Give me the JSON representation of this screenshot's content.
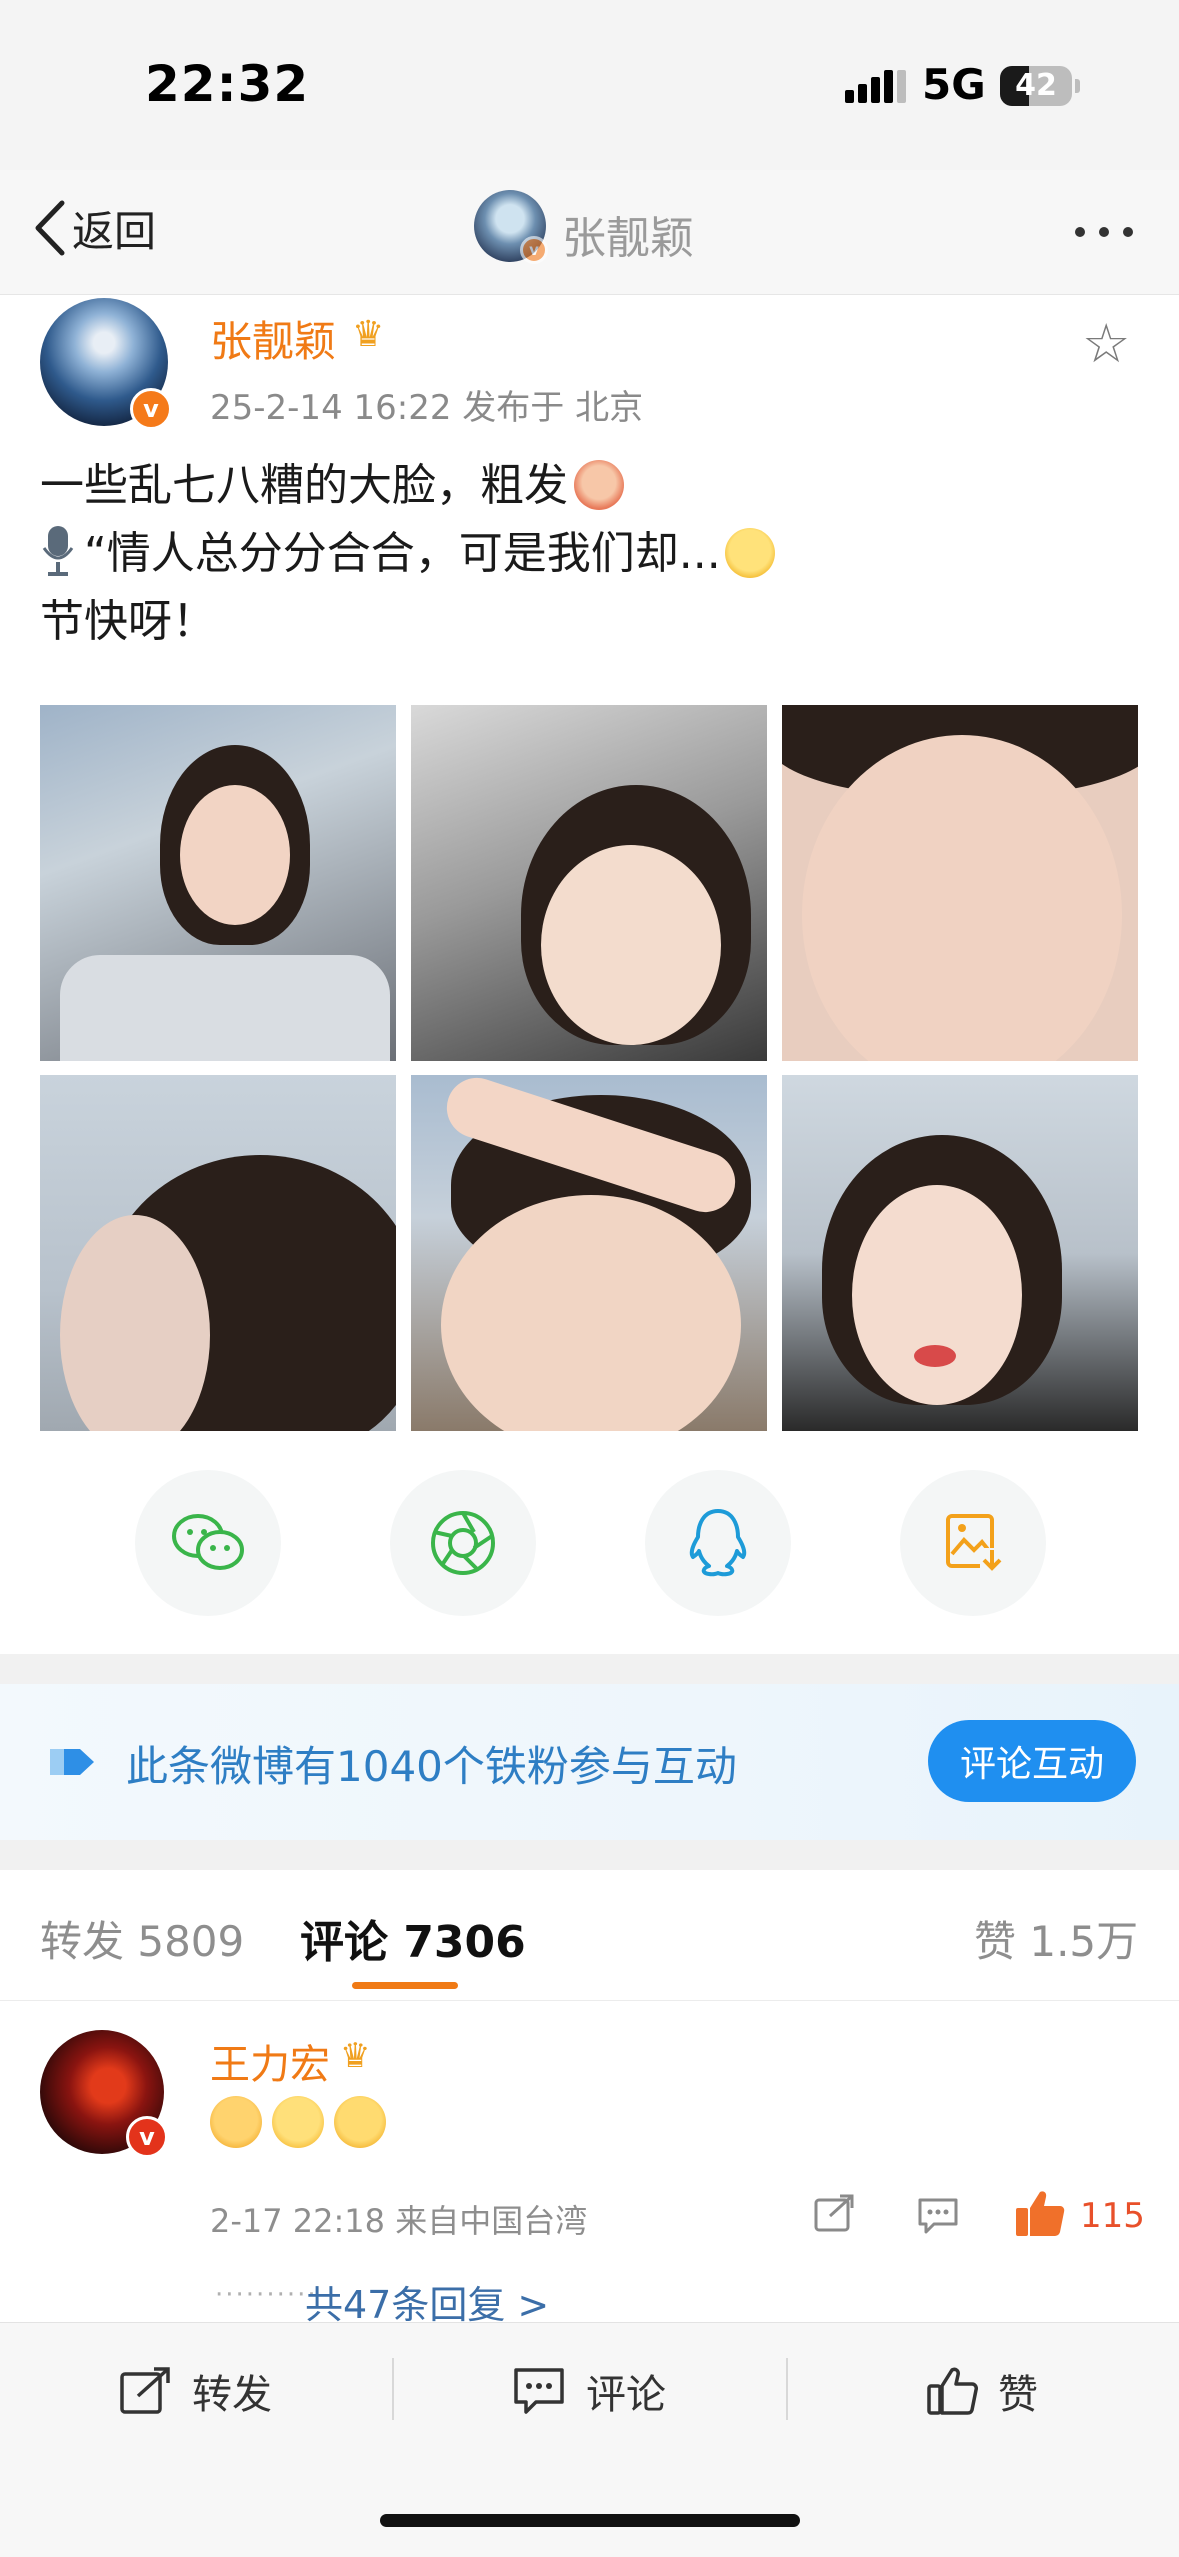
{
  "status_bar": {
    "time": "22:32",
    "network": "5G",
    "battery": "42",
    "battery_level": 0.42
  },
  "nav": {
    "back_label": "返回",
    "title": "张靓颖",
    "more_icon": "more-icon"
  },
  "post": {
    "author": "张靓颖",
    "meta": "25-2-14 16:22  发布于 北京",
    "text_line1": "一些乱七八糟的大脸，粗发",
    "text_line2": "“情人总分分合合，可是我们却...",
    "text_line3": "节快呀！",
    "photos": 6
  },
  "share_buttons": [
    "wechat-icon",
    "moments-icon",
    "qq-icon",
    "save-image-icon"
  ],
  "banner": {
    "text": "此条微博有1040个铁粉参与互动",
    "button": "评论互动"
  },
  "tabs": {
    "repost": "转发 5809",
    "comment": "评论 7306",
    "like": "赞 1.5万"
  },
  "comment": {
    "name": "王力宏",
    "meta": "2-17 22:18  来自中国台湾",
    "like_count": "115",
    "replies": "共47条回复 >"
  },
  "bottom_bar": {
    "repost": "转发",
    "comment": "评论",
    "like": "赞"
  },
  "colors": {
    "accent_orange": "#f07a15",
    "link_blue": "#2e7ec4",
    "button_blue": "#1f8ff0",
    "like_red": "#e8502a"
  }
}
